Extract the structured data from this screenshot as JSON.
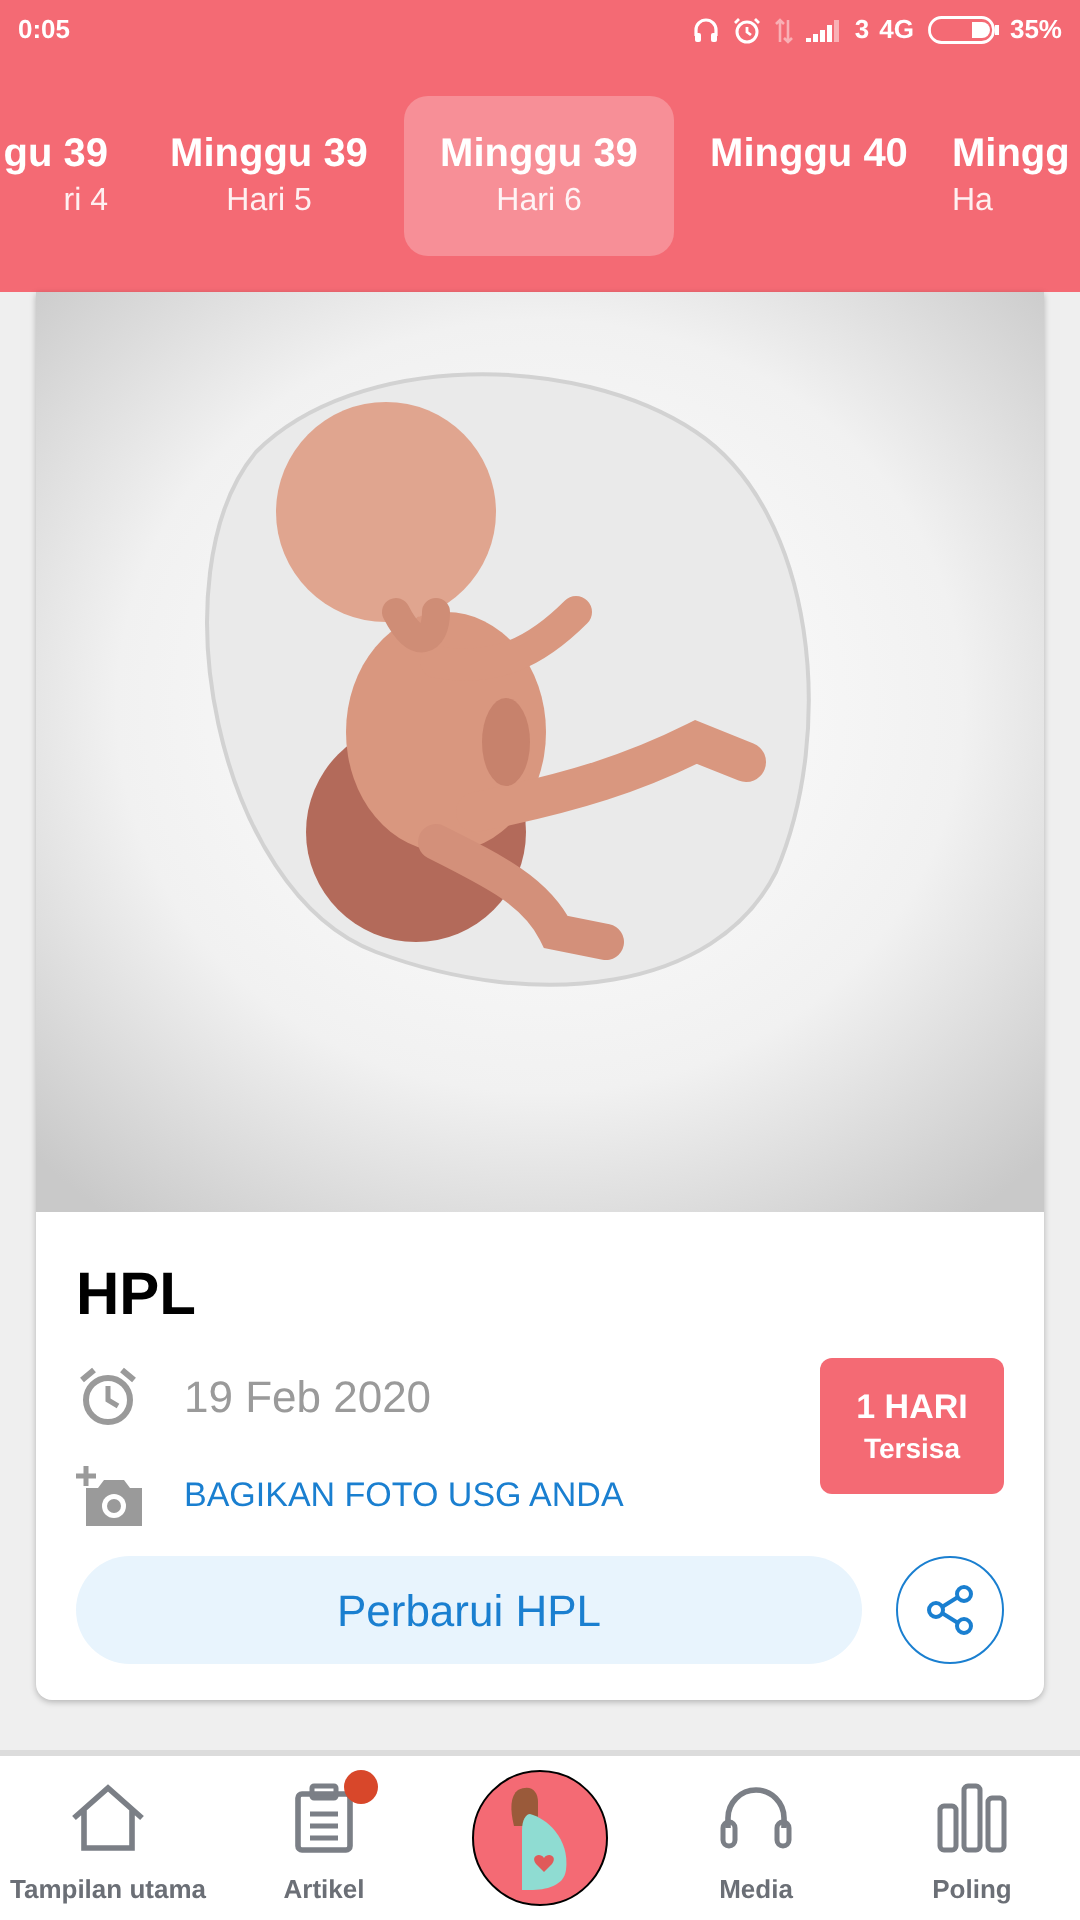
{
  "status_bar": {
    "time": "0:05",
    "sim": "3",
    "network": "4G",
    "battery": "35%"
  },
  "week_tabs": [
    {
      "week": "gu 39",
      "day": "ri 4",
      "selected": false
    },
    {
      "week": "Minggu 39",
      "day": "Hari 5",
      "selected": false
    },
    {
      "week": "Minggu 39",
      "day": "Hari 6",
      "selected": true
    },
    {
      "week": "Minggu 40",
      "selected": false
    },
    {
      "week": "Mingg",
      "day": "Ha",
      "selected": false
    }
  ],
  "card": {
    "title": "HPL",
    "date": "19 Feb 2020",
    "share_photo_link": "BAGIKAN FOTO USG ANDA",
    "countdown": {
      "value": "1 HARI",
      "caption": "Tersisa"
    },
    "update_button": "Perbarui HPL"
  },
  "bottom_nav": [
    {
      "kind": "home",
      "label": "Tampilan utama",
      "badge": false
    },
    {
      "kind": "article",
      "label": "Artikel",
      "badge": true
    },
    {
      "kind": "center"
    },
    {
      "kind": "media",
      "label": "Media",
      "badge": false
    },
    {
      "kind": "poll",
      "label": "Poling",
      "badge": false
    }
  ]
}
